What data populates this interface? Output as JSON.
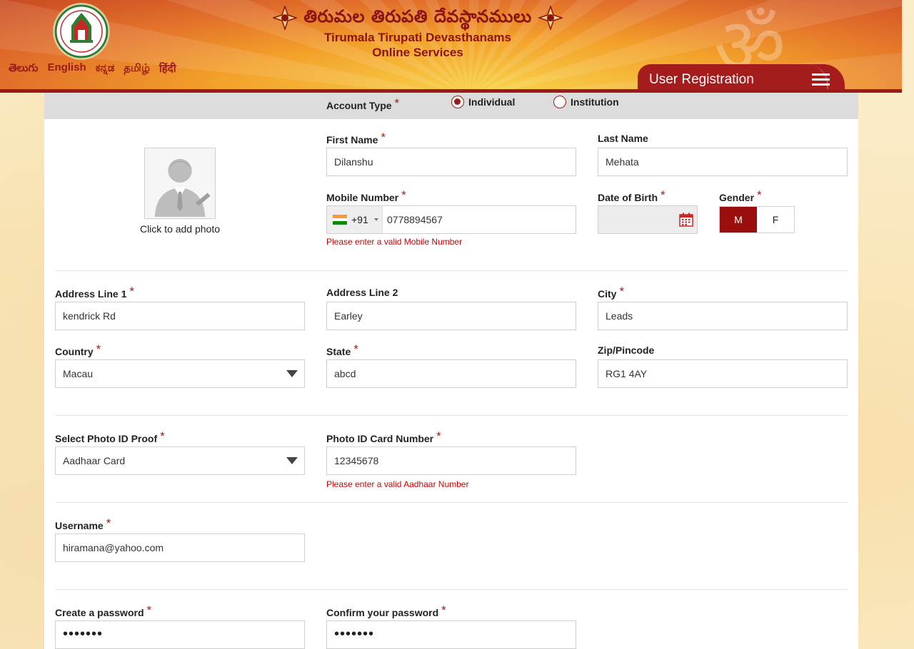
{
  "header": {
    "title_telugu": "తిరుమల తిరుపతి దేవస్థానములు",
    "title_english": "Tirumala Tirupati Devasthanams",
    "subtitle": "Online Services",
    "languages": [
      "తెలుగు",
      "English",
      "ಕನ್ನಡ",
      "தமிழ்",
      "हिंदी"
    ],
    "page_tab": "User Registration"
  },
  "form": {
    "account_type": {
      "label": "Account Type",
      "options": [
        "Individual",
        "Institution"
      ],
      "selected": "Individual"
    },
    "photo": {
      "caption": "Click to add photo"
    },
    "first_name": {
      "label": "First Name",
      "value": "Dilanshu"
    },
    "last_name": {
      "label": "Last Name",
      "value": "Mehata"
    },
    "mobile": {
      "label": "Mobile Number",
      "country_code": "+91",
      "value": "0778894567",
      "error": "Please enter a valid Mobile Number"
    },
    "dob": {
      "label": "Date of Birth",
      "value": ""
    },
    "gender": {
      "label": "Gender",
      "options": [
        "M",
        "F"
      ],
      "selected": "M"
    },
    "address1": {
      "label": "Address Line 1",
      "value": "kendrick Rd"
    },
    "address2": {
      "label": "Address Line 2",
      "value": "Earley"
    },
    "city": {
      "label": "City",
      "value": "Leads"
    },
    "country": {
      "label": "Country",
      "value": "Macau"
    },
    "state": {
      "label": "State",
      "value": "abcd"
    },
    "zip": {
      "label": "Zip/Pincode",
      "value": "RG1 4AY"
    },
    "photo_id_proof": {
      "label": "Select Photo ID Proof",
      "value": "Aadhaar Card"
    },
    "photo_id_number": {
      "label": "Photo ID Card Number",
      "value": "12345678",
      "error": "Please enter a valid Aadhaar Number"
    },
    "username": {
      "label": "Username",
      "value": "hiramana@yahoo.com"
    },
    "password": {
      "label": "Create a password",
      "masked": "•••••••"
    },
    "confirm_password": {
      "label": "Confirm your password",
      "masked": "•••••••"
    }
  },
  "colors": {
    "brand_maroon": "#9b1b1b",
    "error_red": "#d10000",
    "header_orange": "#f3a12a"
  },
  "icons": [
    "logo-emblem",
    "ornament-icon",
    "hamburger-icon",
    "avatar-placeholder-icon",
    "india-flag-icon",
    "calendar-icon",
    "dropdown-caret-icon"
  ]
}
